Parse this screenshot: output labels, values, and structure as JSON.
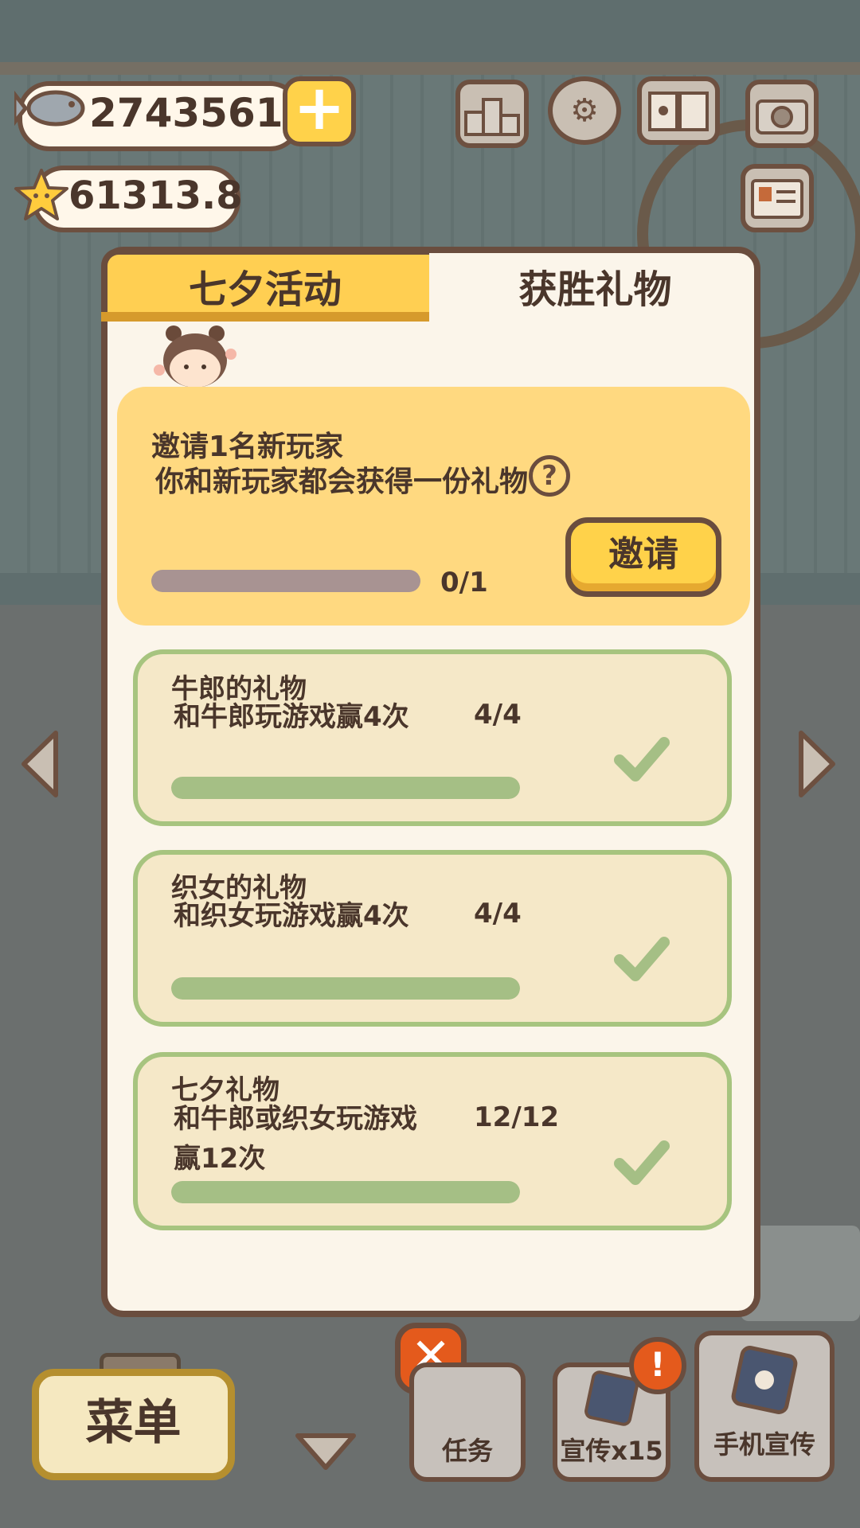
{
  "currency": {
    "fish_amount": "2743561",
    "star_amount": "61313.8"
  },
  "icons": {
    "fish": "fish-icon",
    "star": "star-icon",
    "plus": "plus-icon",
    "ranking": "ranking-podium-icon",
    "settings": "gear-icon",
    "book": "paw-book-icon",
    "camera": "camera-icon",
    "card": "id-card-icon",
    "help": "question-icon",
    "check": "checkmark-icon",
    "close": "close-icon",
    "alert": "exclamation-icon",
    "left_arrow": "chevron-left-icon",
    "right_arrow": "chevron-right-icon",
    "down_arrow": "chevron-down-icon"
  },
  "tabs": [
    {
      "label": "七夕活动",
      "active": false
    },
    {
      "label": "获胜礼物",
      "active": true
    }
  ],
  "invite": {
    "line1": "邀请1名新玩家",
    "line2": "你和新玩家都会获得一份礼物",
    "help_glyph": "?",
    "progress_text": "0/1",
    "progress": 0,
    "button_label": "邀请"
  },
  "tasks": [
    {
      "title": "牛郎的礼物",
      "desc": "和牛郎玩游戏赢4次",
      "desc2": "",
      "count": "4/4",
      "progress": 1.0,
      "done": true
    },
    {
      "title": "织女的礼物",
      "desc": "和织女玩游戏赢4次",
      "desc2": "",
      "count": "4/4",
      "progress": 1.0,
      "done": true
    },
    {
      "title": "七夕礼物",
      "desc": "和牛郎或织女玩游戏",
      "desc2": "赢12次",
      "count": "12/12",
      "progress": 1.0,
      "done": true
    }
  ],
  "bottom": {
    "menu_label": "菜单",
    "tasks_label": "任务",
    "promo_label": "宣传x15",
    "phone_promo_label": "手机宣传",
    "alert_glyph": "!"
  },
  "colors": {
    "tab_active_yellow": "#ffcf52",
    "invite_card": "#ffd980",
    "task_card": "#f5e8c8",
    "task_border": "#a7c47f",
    "progress_fill": "#a5bf85",
    "close_orange": "#e45a1c",
    "outline_brown": "#6a4d3e"
  }
}
